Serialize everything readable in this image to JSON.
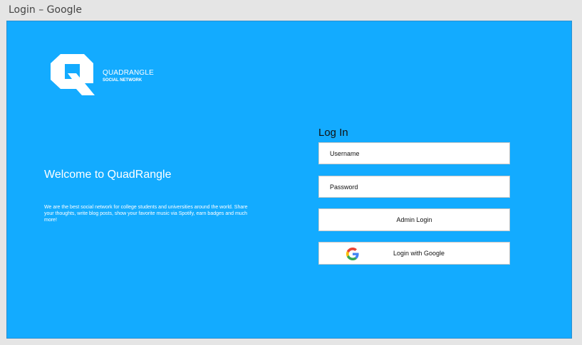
{
  "window": {
    "title": "Login – Google"
  },
  "brand": {
    "name": "QUADRANGLE",
    "tagline": "SOCIAL NETWORK",
    "logo_icon": "quadrangle-q-logo"
  },
  "welcome": {
    "title": "Welcome to QuadRangle",
    "description": "We are the best social network for college students and universities around the world. Share your thoughts, write blog posts, show your favorite music via Spotify, earn badges and much more!"
  },
  "login": {
    "heading": "Log In",
    "username_placeholder": "Username",
    "password_placeholder": "Password",
    "admin_button_label": "Admin Login",
    "google_button_label": "Login with Google",
    "google_icon": "google-g-icon"
  },
  "colors": {
    "background": "#13abff",
    "field_background": "#ffffff",
    "text_on_background": "#ffffff"
  }
}
